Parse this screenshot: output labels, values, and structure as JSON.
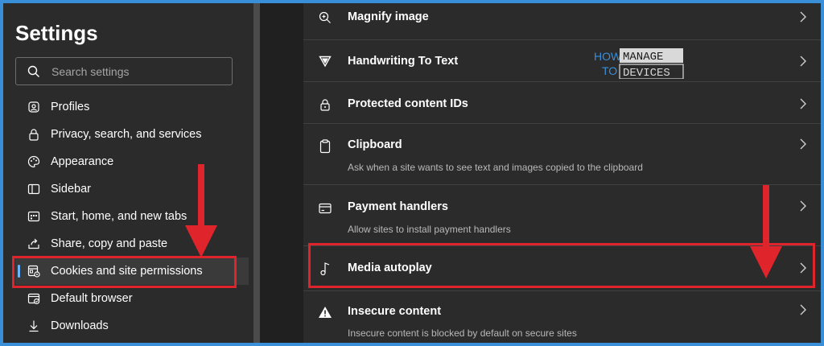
{
  "sidebar": {
    "title": "Settings",
    "search": {
      "placeholder": "Search settings",
      "icon": "search-icon"
    },
    "items": [
      {
        "label": "Profiles",
        "icon": "profile-icon"
      },
      {
        "label": "Privacy, search, and services",
        "icon": "lock-icon"
      },
      {
        "label": "Appearance",
        "icon": "palette-icon"
      },
      {
        "label": "Sidebar",
        "icon": "sidebar-icon"
      },
      {
        "label": "Start, home, and new tabs",
        "icon": "home-tabs-icon"
      },
      {
        "label": "Share, copy and paste",
        "icon": "share-icon"
      },
      {
        "label": "Cookies and site permissions",
        "icon": "cookie-permissions-icon",
        "active": true
      },
      {
        "label": "Default browser",
        "icon": "default-browser-icon"
      },
      {
        "label": "Downloads",
        "icon": "download-icon"
      }
    ]
  },
  "main": {
    "rows": [
      {
        "title": "Magnify image",
        "desc": "",
        "icon": "magnify-icon"
      },
      {
        "title": "Handwriting To Text",
        "desc": "",
        "icon": "handwriting-icon"
      },
      {
        "title": "Protected content IDs",
        "desc": "",
        "icon": "lock-icon"
      },
      {
        "title": "Clipboard",
        "desc": "Ask when a site wants to see text and images copied to the clipboard",
        "icon": "clipboard-icon"
      },
      {
        "title": "Payment handlers",
        "desc": "Allow sites to install payment handlers",
        "icon": "card-icon"
      },
      {
        "title": "Media autoplay",
        "desc": "",
        "icon": "music-note-icon"
      },
      {
        "title": "Insecure content",
        "desc": "Insecure content is blocked by default on secure sites",
        "icon": "warning-icon"
      }
    ]
  },
  "logo": {
    "line1": "HOW",
    "line2": "TO",
    "word1": "MANAGE",
    "word2": "DEVICES"
  },
  "colors": {
    "highlight": "#e0242b",
    "accent": "#6cb6ff",
    "sidebar_bg": "#2b2b2b",
    "border": "#3a8fd9"
  }
}
